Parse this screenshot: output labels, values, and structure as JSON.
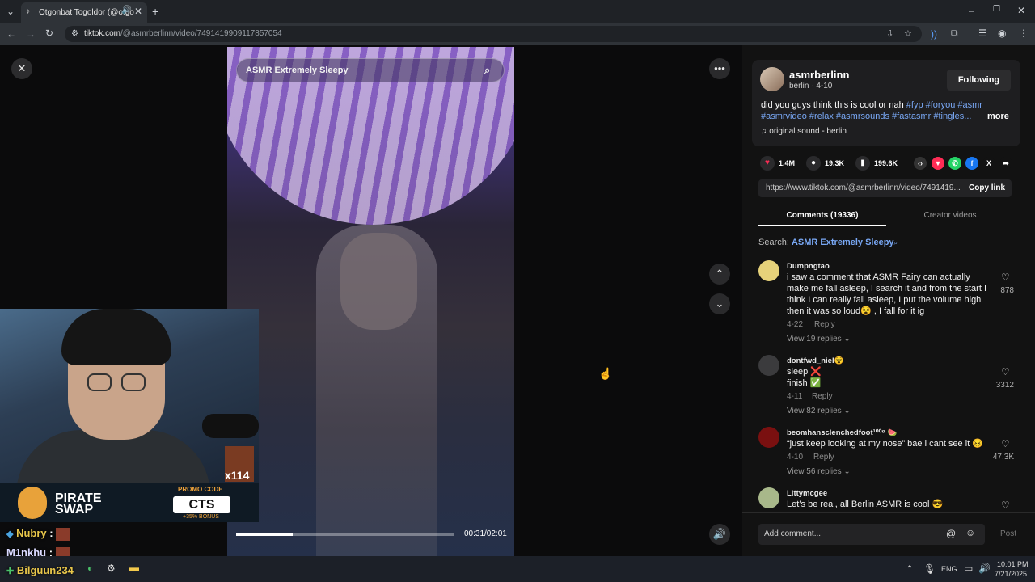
{
  "browser": {
    "tab_title": "Otgonbat Togoldor (@otgo",
    "url_host": "tiktok.com",
    "url_path": "/@asmrberlinn/video/7491419909117857054",
    "icons": [
      "tiktok-favicon",
      "speaker-icon",
      "close-icon",
      "new-tab-icon",
      "back-icon",
      "forward-icon",
      "reload-icon",
      "site-info-icon",
      "install-icon",
      "bookmark-star-icon",
      "extensions-icon",
      "profile-icon",
      "menu-icon"
    ]
  },
  "video": {
    "search_text": "ASMR Extremely Sleepy",
    "time": "00:31/02:01",
    "progress": 0.26
  },
  "creator": {
    "username": "asmrberlinn",
    "subline": "berlin · 4-10",
    "follow_label": "Following",
    "caption_plain": "did you guys think this is cool or nah",
    "hashtags_line1": "#fyp #foryou #asmr",
    "hashtags_line2": "#asmrvideo #relax #asmrsounds #fastasmr #tingles...",
    "more_label": "more",
    "sound": "original sound - berlin"
  },
  "stats": {
    "likes": "1.4M",
    "comments": "19.3K",
    "saves": "199.6K"
  },
  "share": {
    "link": "https://www.tiktok.com/@asmrberlinn/video/7491419...",
    "copy_label": "Copy link"
  },
  "tabs": {
    "comments": "Comments (19336)",
    "creator": "Creator videos"
  },
  "search_hint": {
    "prefix": "Search:",
    "term": "ASMR Extremely Sleepy"
  },
  "comments": [
    {
      "user": "Dumpngtao",
      "lines": [
        "i saw a comment that ASMR Fairy can actually",
        "make me fall asleep, I search it and from the start I",
        "think I can really fall asleep, I put the volume high",
        "then it was so loud😵 , I fall for it ig"
      ],
      "date": "4-22",
      "reply": "Reply",
      "replies": "View 19 replies",
      "likes": "878"
    },
    {
      "user": "dontfwd_niel😵",
      "lines": [
        "sleep ❌",
        "finish ✅"
      ],
      "date": "4-11",
      "reply": "Reply",
      "replies": "View 82 replies",
      "likes": "3312"
    },
    {
      "user": "beomhansclenchedfoot¹⁰⁰⁹ 🍉",
      "lines": [
        "“just keep looking at my nose” bae i cant see it 😣"
      ],
      "date": "4-10",
      "reply": "Reply",
      "replies": "View 56 replies",
      "likes": "47.3K"
    },
    {
      "user": "Littymcgee",
      "lines": [
        "Let’s be real, all Berlin ASMR is cool 😎"
      ],
      "date": "",
      "reply": "",
      "replies": "",
      "likes": ""
    }
  ],
  "comment_input": {
    "placeholder": "Add comment...",
    "post_label": "Post"
  },
  "stream": {
    "sponsor_name_1": "PIRATE",
    "sponsor_name_2": "SWAP",
    "promo_title": "PROMO CODE",
    "promo_code": "CTS",
    "promo_bonus": "+35% BONUS",
    "badge_count": "x114",
    "chat": [
      {
        "user": "Nubry",
        "sep": ":"
      },
      {
        "user": "M1nkhu",
        "sep": ":"
      },
      {
        "user": "Bilguun234",
        "sep": ""
      }
    ]
  },
  "taskbar": {
    "lang": "ENG",
    "time": "10:01 PM",
    "date": "7/21/2025"
  }
}
